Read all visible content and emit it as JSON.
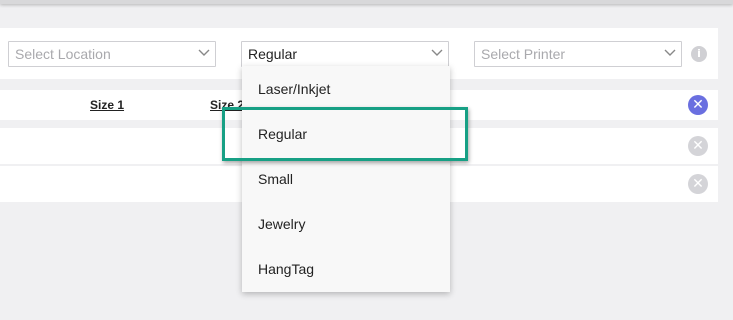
{
  "filters": {
    "location": {
      "placeholder": "Select Location"
    },
    "label_type": {
      "value": "Regular"
    },
    "printer": {
      "placeholder": "Select Printer"
    }
  },
  "table": {
    "columns": [
      "Size 1",
      "Size 2"
    ]
  },
  "dropdown": {
    "options": [
      "Laser/Inkjet",
      "Regular",
      "Small",
      "Jewelry",
      "HangTag"
    ],
    "highlighted": "Regular"
  },
  "icons": {
    "info": "info-icon",
    "remove": "close-icon",
    "chevron": "chevron-down-icon"
  },
  "colors": {
    "accent": "#6a6fe0",
    "highlight_border": "#17a085",
    "muted": "#d4d4d8"
  }
}
